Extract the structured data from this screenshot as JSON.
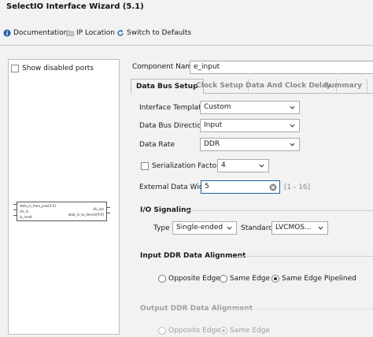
{
  "window": {
    "title": "SelectIO Interface Wizard (5.1)"
  },
  "toolbar": {
    "documentation": "Documentation",
    "ip_location": "IP Location",
    "switch_defaults": "Switch to Defaults"
  },
  "left": {
    "show_disabled_ports": "Show disabled ports",
    "block": {
      "in_ports": [
        "data_in_from_pins[4:0]",
        "clk_in",
        "io_reset"
      ],
      "out_ports": [
        "clk_out",
        "data_in_to_device[9:0]"
      ]
    }
  },
  "form": {
    "component_name_label": "Component Name",
    "component_name_value": "e_input",
    "tabs": [
      "Data Bus Setup",
      "Clock Setup",
      "Data And Clock Delay",
      "Summary"
    ],
    "interface_template_label": "Interface Template",
    "interface_template_value": "Custom",
    "data_bus_direction_label": "Data Bus Direction",
    "data_bus_direction_value": "Input",
    "data_rate_label": "Data Rate",
    "data_rate_value": "DDR",
    "serialization_factor_label": "Serialization Factor",
    "serialization_factor_value": "4",
    "external_data_width_label": "External Data Width",
    "external_data_width_value": "5",
    "external_data_width_range": "[1 - 16]",
    "io_signaling_title": "I/O Signaling",
    "type_label": "Type",
    "type_value": "Single-ended",
    "standard_label": "Standard",
    "standard_value": "LVCMOS...",
    "input_ddr_title": "Input DDR Data Alignment",
    "input_ddr_options": [
      "Opposite Edge",
      "Same Edge",
      "Same Edge Pipelined"
    ],
    "input_ddr_selected": "Same Edge Pipelined",
    "output_ddr_title": "Output DDR Data Alignment",
    "output_ddr_options": [
      "Opposite Edge",
      "Same Edge"
    ],
    "output_ddr_selected": "Same Edge"
  },
  "colors": {
    "accent_blue": "#1f5fa8",
    "disabled_text": "#a0a0a0",
    "background": "#f2f2f2"
  }
}
